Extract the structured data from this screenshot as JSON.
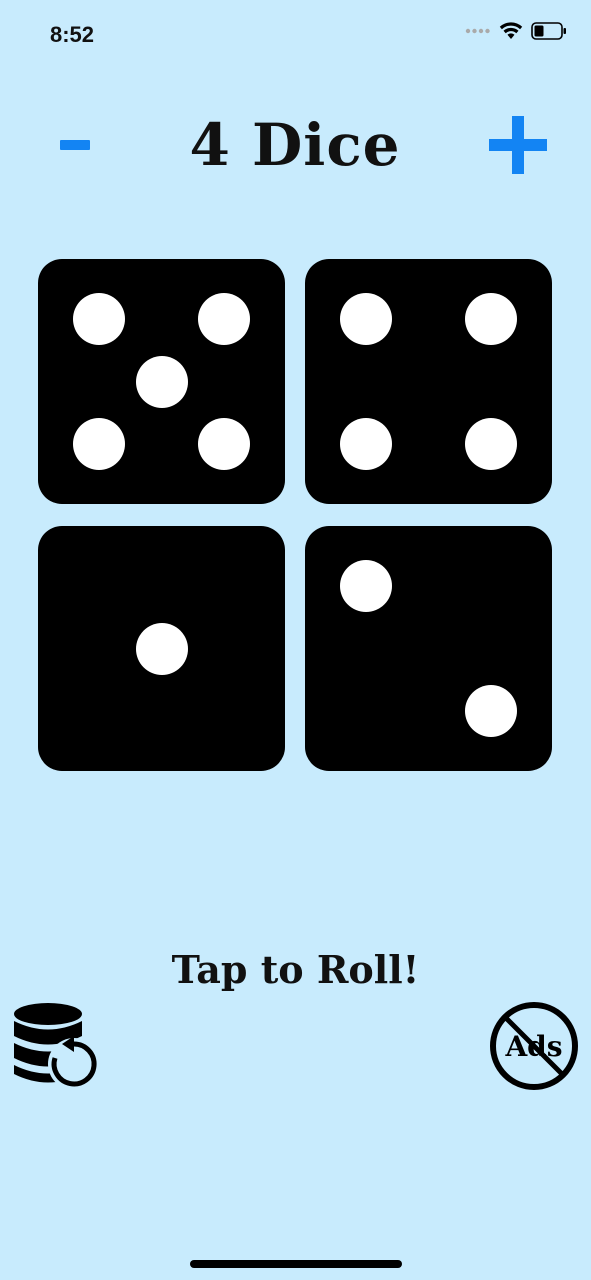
{
  "status_bar": {
    "time": "8:52",
    "icons": [
      "cellular-signal-icon",
      "wifi-icon",
      "battery-icon"
    ]
  },
  "header": {
    "title": "4 Dice",
    "minus_icon": "minus-icon",
    "plus_icon": "plus-icon",
    "accent_color": "#1384f3"
  },
  "dice": {
    "count": 4,
    "values": [
      5,
      4,
      1,
      2
    ]
  },
  "roll_label": "Tap to Roll!",
  "bottom_bar": {
    "history_icon": "database-reset-icon",
    "no_ads_icon": "no-ads-icon",
    "no_ads_text": "Ads"
  },
  "colors": {
    "background": "#c8ebfd",
    "die": "#000000",
    "pip": "#ffffff",
    "accent": "#1384f3"
  }
}
